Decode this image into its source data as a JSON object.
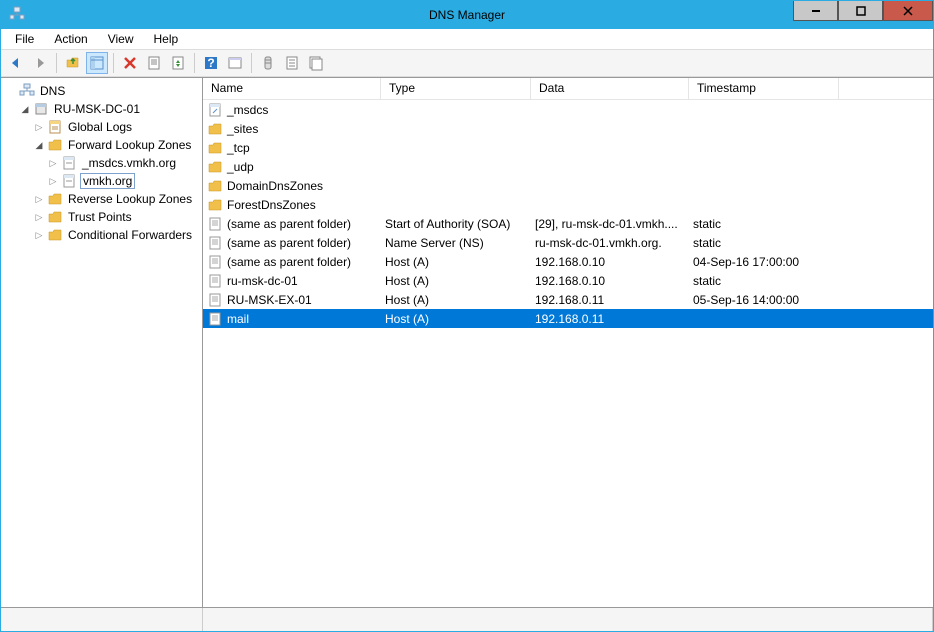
{
  "window": {
    "title": "DNS Manager"
  },
  "menu": {
    "file": "File",
    "action": "Action",
    "view": "View",
    "help": "Help"
  },
  "tree": {
    "root": "DNS",
    "server": "RU-MSK-DC-01",
    "globalLogs": "Global Logs",
    "forwardZones": "Forward Lookup Zones",
    "zone1": "_msdcs.vmkh.org",
    "zone2": "vmkh.org",
    "reverseZones": "Reverse Lookup Zones",
    "trustPoints": "Trust Points",
    "condForwarders": "Conditional Forwarders"
  },
  "columns": {
    "name": "Name",
    "type": "Type",
    "data": "Data",
    "timestamp": "Timestamp"
  },
  "rows": [
    {
      "name": "_msdcs",
      "type": "",
      "data": "",
      "timestamp": "",
      "icon": "folder-link"
    },
    {
      "name": "_sites",
      "type": "",
      "data": "",
      "timestamp": "",
      "icon": "folder"
    },
    {
      "name": "_tcp",
      "type": "",
      "data": "",
      "timestamp": "",
      "icon": "folder"
    },
    {
      "name": "_udp",
      "type": "",
      "data": "",
      "timestamp": "",
      "icon": "folder"
    },
    {
      "name": "DomainDnsZones",
      "type": "",
      "data": "",
      "timestamp": "",
      "icon": "folder"
    },
    {
      "name": "ForestDnsZones",
      "type": "",
      "data": "",
      "timestamp": "",
      "icon": "folder"
    },
    {
      "name": "(same as parent folder)",
      "type": "Start of Authority (SOA)",
      "data": "[29], ru-msk-dc-01.vmkh....",
      "timestamp": "static",
      "icon": "record"
    },
    {
      "name": "(same as parent folder)",
      "type": "Name Server (NS)",
      "data": "ru-msk-dc-01.vmkh.org.",
      "timestamp": "static",
      "icon": "record"
    },
    {
      "name": "(same as parent folder)",
      "type": "Host (A)",
      "data": "192.168.0.10",
      "timestamp": "04-Sep-16 17:00:00",
      "icon": "record"
    },
    {
      "name": "ru-msk-dc-01",
      "type": "Host (A)",
      "data": "192.168.0.10",
      "timestamp": "static",
      "icon": "record"
    },
    {
      "name": "RU-MSK-EX-01",
      "type": "Host (A)",
      "data": "192.168.0.11",
      "timestamp": "05-Sep-16 14:00:00",
      "icon": "record"
    },
    {
      "name": "mail",
      "type": "Host (A)",
      "data": "192.168.0.11",
      "timestamp": "",
      "icon": "record",
      "selected": true
    }
  ],
  "colWidths": {
    "name": 178,
    "type": 150,
    "data": 158,
    "timestamp": 150
  }
}
